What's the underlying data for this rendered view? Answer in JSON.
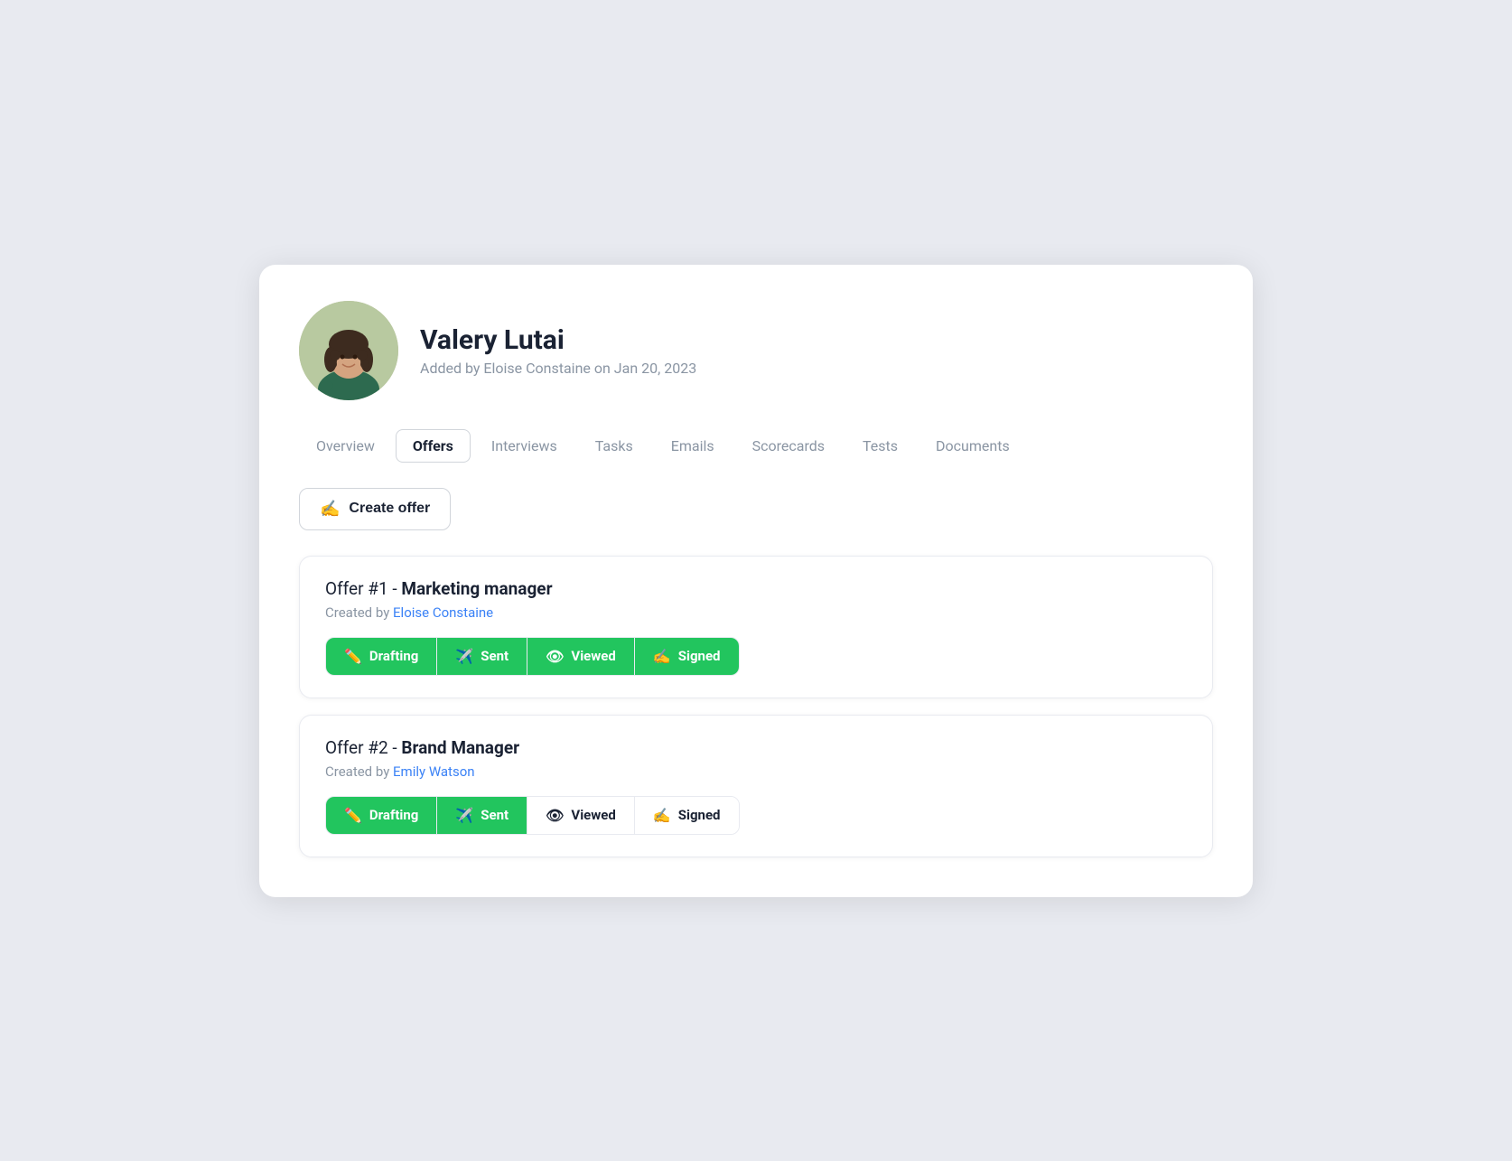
{
  "profile": {
    "name": "Valery Lutai",
    "subtitle": "Added by Eloise Constaine on Jan 20, 2023"
  },
  "tabs": [
    {
      "label": "Overview",
      "active": false
    },
    {
      "label": "Offers",
      "active": true
    },
    {
      "label": "Interviews",
      "active": false
    },
    {
      "label": "Tasks",
      "active": false
    },
    {
      "label": "Emails",
      "active": false
    },
    {
      "label": "Scorecards",
      "active": false
    },
    {
      "label": "Tests",
      "active": false
    },
    {
      "label": "Documents",
      "active": false
    }
  ],
  "create_offer_btn": "Create offer",
  "offers": [
    {
      "title_prefix": "Offer #1 - ",
      "title_bold": "Marketing manager",
      "created_by_label": "Created by ",
      "created_by_name": "Eloise Constaine",
      "steps": [
        {
          "label": "Drafting",
          "icon": "✏️",
          "active": true
        },
        {
          "label": "Sent",
          "icon": "✈️",
          "active": true
        },
        {
          "label": "Viewed",
          "icon": "👁",
          "active": true
        },
        {
          "label": "Signed",
          "icon": "✍️",
          "active": true
        }
      ]
    },
    {
      "title_prefix": "Offer #2 - ",
      "title_bold": "Brand Manager",
      "created_by_label": "Created by ",
      "created_by_name": "Emily Watson",
      "steps": [
        {
          "label": "Drafting",
          "icon": "✏️",
          "active": true
        },
        {
          "label": "Sent",
          "icon": "✈️",
          "active": true
        },
        {
          "label": "Viewed",
          "icon": "👁",
          "active": false
        },
        {
          "label": "Signed",
          "icon": "✍️",
          "active": false
        }
      ]
    }
  ],
  "icons": {
    "create_offer": "✍️"
  }
}
